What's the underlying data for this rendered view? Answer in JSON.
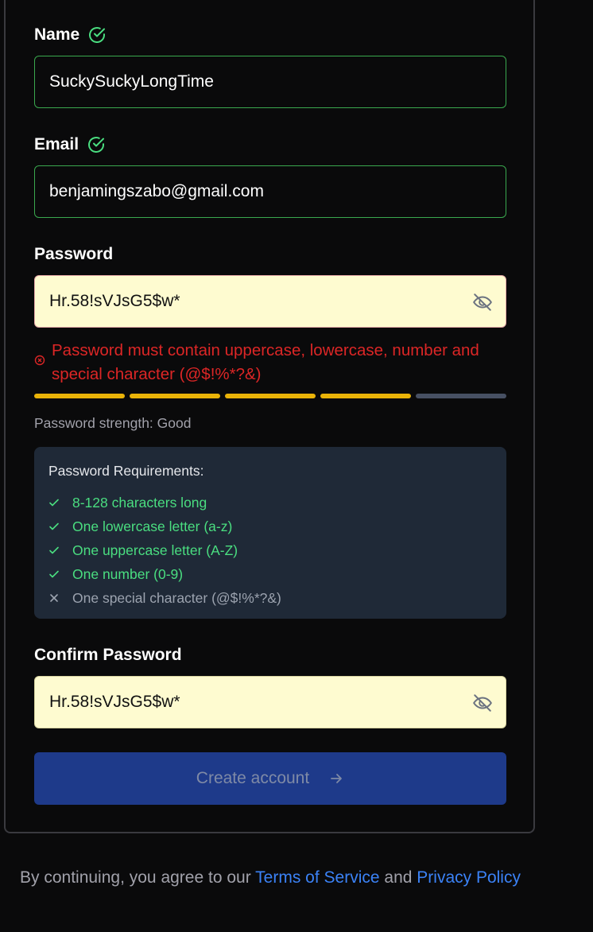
{
  "form": {
    "name": {
      "label": "Name",
      "value": "SuckySuckyLongTime",
      "status_icon": "check-circle-icon"
    },
    "email": {
      "label": "Email",
      "value": "benjamingszabo@gmail.com",
      "status_icon": "check-circle-icon"
    },
    "password": {
      "label": "Password",
      "value": "Hr.58!sVJsG5$w*",
      "toggle_icon": "eye-off-icon",
      "error": "Password must contain uppercase, lowercase, number and special character (@$!%*?&)",
      "strength_level": 4,
      "strength_segments": 5,
      "strength_text": "Password strength: Good"
    },
    "requirements": {
      "title": "Password Requirements:",
      "items": [
        {
          "text": "8-128 characters long",
          "met": true
        },
        {
          "text": "One lowercase letter (a-z)",
          "met": true
        },
        {
          "text": "One uppercase letter (A-Z)",
          "met": true
        },
        {
          "text": "One number (0-9)",
          "met": true
        },
        {
          "text": "One special character (@$!%*?&)",
          "met": false
        }
      ]
    },
    "confirm": {
      "label": "Confirm Password",
      "value": "Hr.58!sVJsG5$w*",
      "toggle_icon": "eye-off-icon"
    },
    "submit_label": "Create account"
  },
  "footer": {
    "prefix": "By continuing, you agree to our",
    "terms": "Terms of Service",
    "and": "and",
    "privacy": "Privacy Policy"
  },
  "colors": {
    "success": "#4ade80",
    "error": "#dc2626",
    "strength": "#eab308",
    "link": "#3b82f6",
    "button": "#1e3a8a"
  }
}
